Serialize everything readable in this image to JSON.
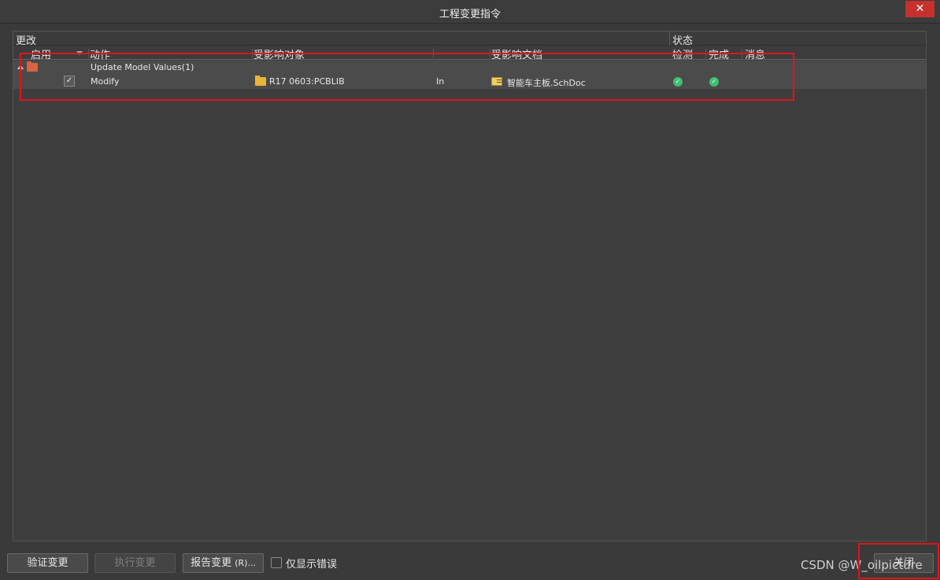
{
  "window": {
    "title": "工程变更指令",
    "close_glyph": "✕"
  },
  "header": {
    "group_changes": "更改",
    "group_status": "状态",
    "columns": {
      "enable": "启用",
      "action": "动作",
      "affected_object": "受影响对象",
      "affected_document": "受影响文档",
      "check": "检测",
      "done": "完成",
      "message": "消息"
    }
  },
  "rows": [
    {
      "type": "group",
      "expander_icon": "collapse-triangle",
      "icon": "red-folder-icon",
      "action": "Update Model Values(1)"
    },
    {
      "type": "item",
      "enabled": true,
      "action": "Modify",
      "affected_object": "R17 0603:PCBLIB",
      "direction": "In",
      "affected_document": "智能车主板.SchDoc",
      "check_status": "ok",
      "done_status": "ok"
    }
  ],
  "buttons": {
    "validate": "验证变更",
    "execute": "执行变更",
    "report_main": "报告变更",
    "report_suffix": "(R)...",
    "close": "关闭"
  },
  "options": {
    "only_errors_label": "仅显示错误",
    "only_errors_checked": false
  },
  "watermark": "CSDN @W_oilpicture",
  "colors": {
    "status_ok": "#3fbf72",
    "highlight": "#e0141b",
    "close_button": "#c7312d"
  }
}
